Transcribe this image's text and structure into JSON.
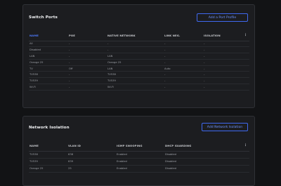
{
  "switch_ports": {
    "title": "Switch Ports",
    "add_button": "Add a Port Profile",
    "columns": [
      "NAME",
      "POE",
      "NATIVE NETWORK",
      "LINK NEG.",
      "ISOLATION"
    ],
    "menu_glyph": "⋮",
    "rows": [
      {
        "name": "All",
        "poe": "-",
        "native": "-",
        "link": "-",
        "isolation": "-"
      },
      {
        "name": "Disabled",
        "poe": "-",
        "native": "-",
        "link": "-",
        "isolation": "-"
      },
      {
        "name": "LAN",
        "poe": "-",
        "native": "LAN",
        "link": "-",
        "isolation": "-"
      },
      {
        "name": "Orange 25",
        "poe": "-",
        "native": "Orange 25",
        "link": "-",
        "isolation": "-"
      },
      {
        "name": "TV",
        "poe": "Off",
        "native": "LAN",
        "link": "Auto",
        "isolation": "-"
      },
      {
        "name": "TV538",
        "poe": "-",
        "native": "TV538",
        "link": "-",
        "isolation": "-"
      },
      {
        "name": "TV539",
        "poe": "-",
        "native": "TV539",
        "link": "-",
        "isolation": "-"
      },
      {
        "name": "Wi-Fi",
        "poe": "-",
        "native": "Wi-Fi",
        "link": "-",
        "isolation": "-"
      }
    ]
  },
  "network_isolation": {
    "title": "Network Isolation",
    "add_button": "Add Network Isolation",
    "columns": [
      "NAME",
      "VLAN ID",
      "IGMP SNOOPING",
      "DHCP GUARDING"
    ],
    "menu_glyph": "⋮",
    "rows": [
      {
        "name": "TV538",
        "vlan": "638",
        "igmp": "Enabled",
        "dhcp": "Disabled"
      },
      {
        "name": "TV539",
        "vlan": "639",
        "igmp": "Enabled",
        "dhcp": "Disabled"
      },
      {
        "name": "Orange 25",
        "vlan": "25",
        "igmp": "Enabled",
        "dhcp": "Disabled"
      }
    ]
  },
  "colors": {
    "background": "#121315",
    "card": "#1c1d20",
    "accent": "#4f7cff",
    "button_border": "#3f69f0"
  }
}
